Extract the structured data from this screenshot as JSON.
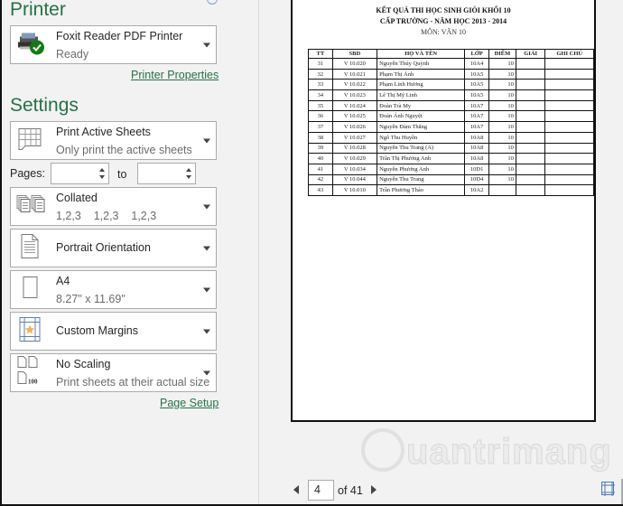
{
  "printer": {
    "section_title": "Printer",
    "name": "Foxit Reader PDF Printer",
    "status": "Ready",
    "properties_link": "Printer Properties",
    "status_color": "#107c10"
  },
  "settings": {
    "section_title": "Settings",
    "print_what": {
      "title": "Print Active Sheets",
      "subtitle": "Only print the active sheets"
    },
    "pages_label": "Pages:",
    "pages_from": "",
    "to_label": "to",
    "pages_to": "",
    "collation": {
      "title": "Collated",
      "subtitle": "1,2,3    1,2,3    1,2,3"
    },
    "orientation": {
      "title": "Portrait Orientation"
    },
    "paper": {
      "title": "A4",
      "subtitle": "8.27\" x 11.69\""
    },
    "margins": {
      "title": "Custom Margins"
    },
    "scaling": {
      "title": "No Scaling",
      "subtitle": "Print sheets at their actual size",
      "icon_text": "100"
    },
    "page_setup_link": "Page Setup"
  },
  "preview": {
    "title_line1": "KẾT QUẢ THI HỌC SINH GIỎI KHỐI 10",
    "title_line2": "CẤP TRƯỜNG - NĂM HỌC 2013 - 2014",
    "subject": "MÔN: VĂN 10",
    "columns": [
      "TT",
      "SBD",
      "HỌ VÀ TÊN",
      "LỚP",
      "ĐIỂM",
      "GIẢI",
      "GHI CHÚ"
    ],
    "rows": [
      [
        "31",
        "V 10.020",
        "Nguyễn Thúy Quỳnh",
        "10A4",
        "10",
        "",
        ""
      ],
      [
        "32",
        "V 10.021",
        "Phạm Thị Ánh",
        "10A5",
        "10",
        "",
        ""
      ],
      [
        "33",
        "V 10.022",
        "Phạm Linh Hương",
        "10A5",
        "10",
        "",
        ""
      ],
      [
        "34",
        "V 10.023",
        "Lê Thị Mỹ Linh",
        "10A5",
        "10",
        "",
        ""
      ],
      [
        "35",
        "V 10.024",
        "Đoàn Trà My",
        "10A7",
        "10",
        "",
        ""
      ],
      [
        "36",
        "V 10.025",
        "Đoàn Ánh Nguyệt",
        "10A7",
        "10",
        "",
        ""
      ],
      [
        "37",
        "V 10.026",
        "Nguyễn Đàm Thắng",
        "10A7",
        "10",
        "",
        ""
      ],
      [
        "38",
        "V 10.027",
        "Ngô Thu Huyền",
        "10A8",
        "10",
        "",
        ""
      ],
      [
        "39",
        "V 10.028",
        "Nguyễn Thu Trang (A)",
        "10A8",
        "10",
        "",
        ""
      ],
      [
        "40",
        "V 10.029",
        "Trần Thị Phương Anh",
        "10A8",
        "10",
        "",
        ""
      ],
      [
        "41",
        "V 10.034",
        "Nguyễn Phương Anh",
        "10D1",
        "10",
        "",
        ""
      ],
      [
        "42",
        "V 10.044",
        "Nguyễn Thu Trang",
        "10D4",
        "10",
        "",
        ""
      ],
      [
        "43",
        "V 10.010",
        "Trần Phương Thảo",
        "10A2",
        "",
        "",
        ""
      ]
    ]
  },
  "navigation": {
    "current_page": "4",
    "of_label": "of 41"
  },
  "watermark": "uantrimang"
}
